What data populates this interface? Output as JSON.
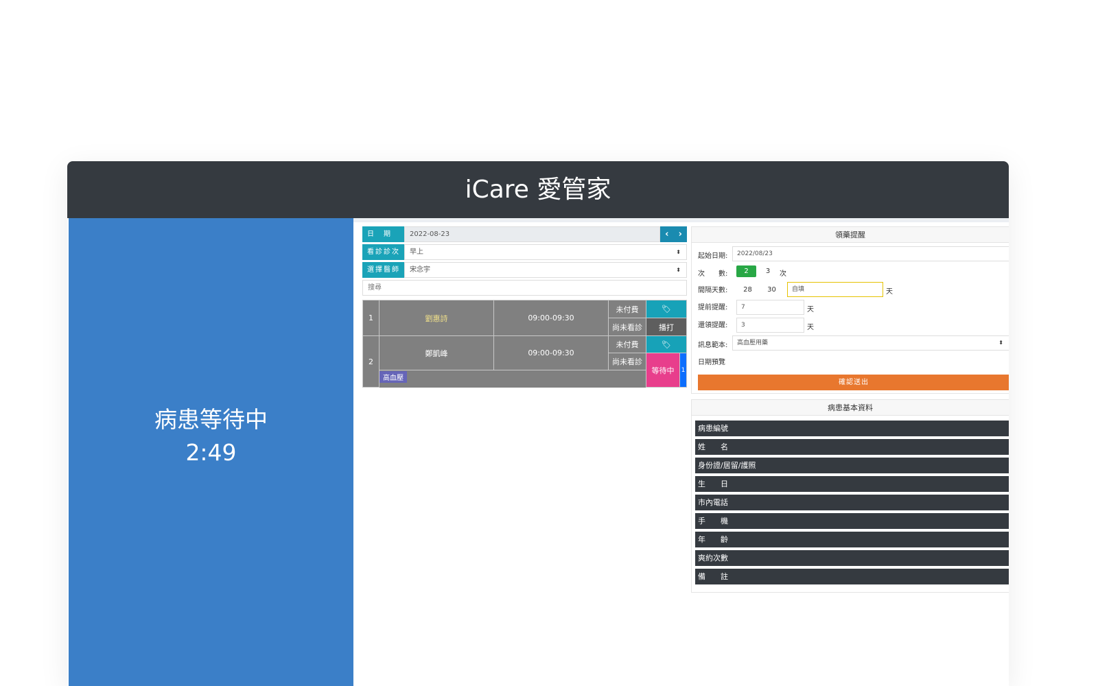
{
  "app": {
    "title": "iCare 愛管家"
  },
  "left_panel": {
    "line1": "病患等待中",
    "line2": "2:49",
    "bg_color": "#3b7fc8"
  },
  "form": {
    "date_label": "日　期",
    "date_value": "2022-08-23",
    "nav_prev_icon": "chevron-left-icon",
    "nav_next_icon": "chevron-right-icon",
    "session_label": "看診診次",
    "session_value": "早上",
    "doctor_label": "選擇醫師",
    "doctor_value": "宋念宇",
    "search_placeholder": "搜尋"
  },
  "appointments": [
    {
      "no": "1",
      "name": "劉惠詩",
      "time": "09:00-09:30",
      "payment": "未付費",
      "status": "尚未看診",
      "action": "播打",
      "action_icon": "tags-icon"
    },
    {
      "no": "2",
      "name": "鄭凱峰",
      "time": "09:00-09:30",
      "payment": "未付費",
      "status": "尚未看診",
      "action": "等待中",
      "badge": "1",
      "tag": "高血壓",
      "action_icon": "tags-icon"
    }
  ],
  "reminder": {
    "title": "領藥提醒",
    "start_label": "起始日期:",
    "start_value": "2022/08/23",
    "count_label": "次　　數:",
    "count_options": [
      "2",
      "3"
    ],
    "count_selected": "2",
    "count_unit": "次",
    "interval_label": "間隔天數:",
    "interval_options": [
      "28",
      "30"
    ],
    "interval_input": "自填",
    "interval_unit": "天",
    "advance_label": "提前提醒:",
    "advance_value": "7",
    "advance_unit": "天",
    "repeat_label": "還領提醒:",
    "repeat_value": "3",
    "repeat_unit": "天",
    "template_label": "訊息範本:",
    "template_value": "高血壓用藥",
    "preview_label": "日期預覽",
    "submit_label": "確認送出"
  },
  "patient_info": {
    "title": "病患基本資料",
    "fields": [
      "病患編號",
      "姓　　名",
      "身份證/居留/護照",
      "生　　日",
      "市內電話",
      "手　　機",
      "年　　齡",
      "爽約次數",
      "備　　註"
    ]
  },
  "colors": {
    "header": "#353a40",
    "teal": "#17a2b8",
    "orange": "#e8772e",
    "green": "#28a745",
    "pink": "#e83e8c"
  }
}
